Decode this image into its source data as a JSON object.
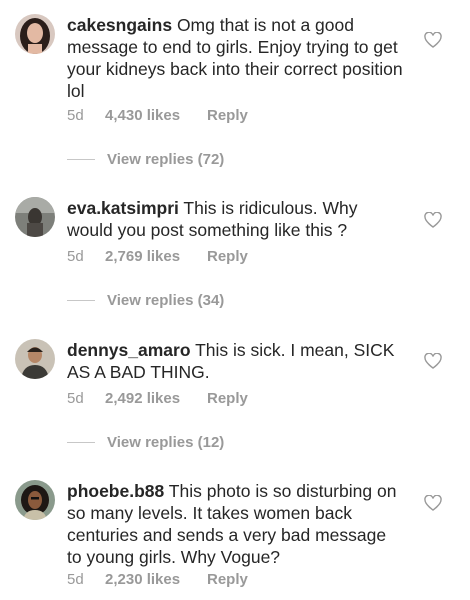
{
  "comments": [
    {
      "username": "cakesngains",
      "text": "Omg that is not a good message to end to girls. Enjoy trying to get your kidneys back into their correct position lol",
      "age": "5d",
      "likes": "4,430 likes",
      "reply_label": "Reply",
      "view_replies": "View replies (72)"
    },
    {
      "username": "eva.katsimpri",
      "text": "This is ridiculous. Why would you post something like this ?",
      "age": "5d",
      "likes": "2,769 likes",
      "reply_label": "Reply",
      "view_replies": "View replies (34)"
    },
    {
      "username": "dennys_amaro",
      "text": "This is sick. I mean, SICK AS A BAD THING.",
      "age": "5d",
      "likes": "2,492 likes",
      "reply_label": "Reply",
      "view_replies": "View replies (12)"
    },
    {
      "username": "phoebe.b88",
      "text": "This photo is so disturbing on so many levels. It takes women back centuries and sends a very bad message to young girls. Why Vogue?",
      "age": "5d",
      "likes": "2,230 likes",
      "reply_label": "Reply"
    }
  ],
  "icons": {
    "like": "heart-outline-icon"
  },
  "colors": {
    "text": "#262626",
    "muted": "#999999",
    "divider": "#c7c7c7"
  }
}
